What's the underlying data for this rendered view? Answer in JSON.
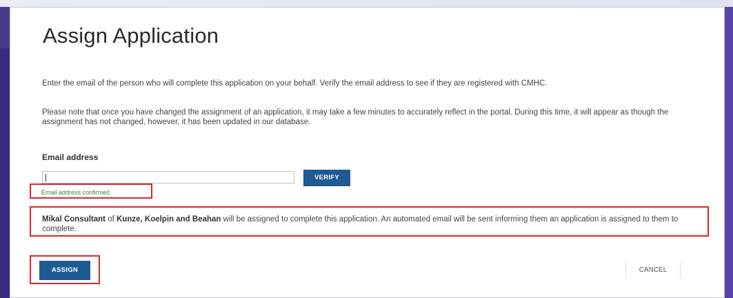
{
  "dialog": {
    "title": "Assign Application",
    "paragraph1": "Enter the email of the person who will complete this application on your behalf. Verify the email address to see if they are registered with CMHC.",
    "paragraph2": "Please note that once you have changed the assignment of an application, it may take a few minutes to accurately reflect in the portal. During this time, it will appear as though the assignment has not changed, however, it has been updated in our database.",
    "email_label": "Email address",
    "email_value": "",
    "verify_label": "VERIFY",
    "confirm_text": "Email address confirmed",
    "assignee_name": "Mikal Consultant",
    "of_word": " of ",
    "assignee_org": "Kunze, Koelpin and Beahan",
    "assign_message_rest": " will be assigned to complete this application. An automated email will be sent informing them an application is assigned to them to complete.",
    "assign_label": "ASSIGN",
    "cancel_label": "CANCEL"
  },
  "colors": {
    "primary_button": "#1e5a94",
    "highlight_border": "#e0242e",
    "success_text": "#2f8a2f",
    "backdrop": "#4a3a8a"
  }
}
